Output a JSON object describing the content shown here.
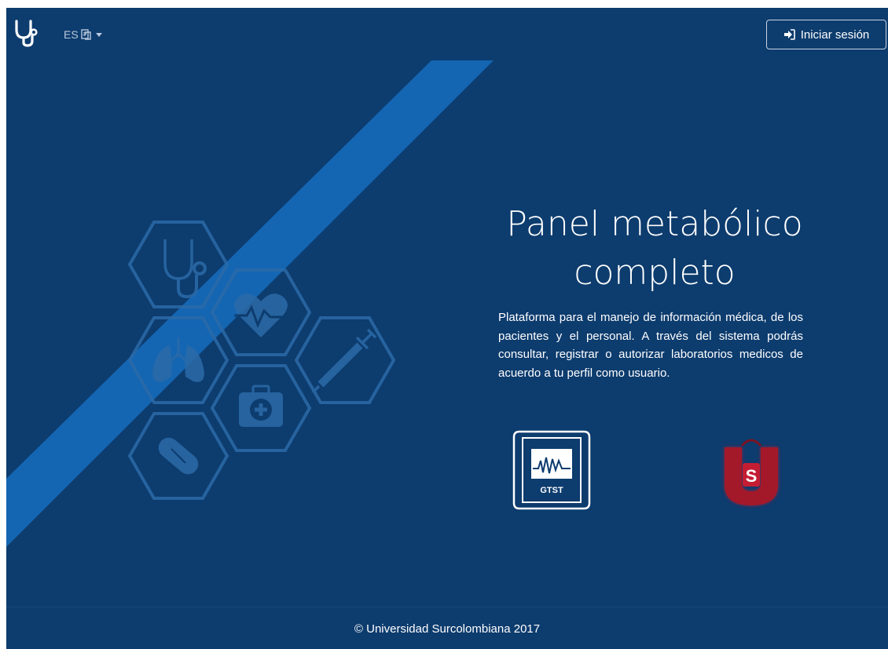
{
  "navbar": {
    "brand_icon": "stethoscope-icon",
    "language": {
      "code": "ES",
      "icon": "language-flag-icon"
    },
    "login": {
      "label": "Iniciar sesión",
      "icon": "sign-in-icon"
    }
  },
  "hero": {
    "title_line1": "Panel metabólico",
    "title_line2": "completo",
    "description": "Plataforma para el manejo de información médica, de los pacientes y el personal. A través del sistema podrás consultar, registrar o autorizar laboratorios medicos de acuerdo a tu perfil como usuario."
  },
  "decorations": {
    "hex_icons": [
      "stethoscope-icon",
      "heart-pulse-icon",
      "lungs-icon",
      "syringe-icon",
      "medical-kit-icon",
      "pill-icon"
    ]
  },
  "logos": {
    "gtst": {
      "text": "GTST"
    },
    "usco": {
      "text": "S"
    }
  },
  "footer": {
    "copyright": "© Universidad Surcolombiana 2017"
  },
  "colors": {
    "background": "#0d3c6e",
    "band": "#1466b3",
    "usco_red": "#a3192a",
    "hex_stroke": "#2b6aa8"
  }
}
